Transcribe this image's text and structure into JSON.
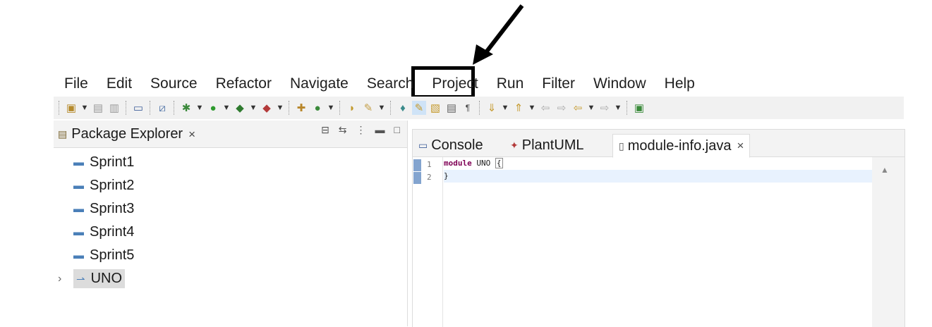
{
  "menubar": {
    "items": [
      "File",
      "Edit",
      "Source",
      "Refactor",
      "Navigate",
      "Search",
      "Project",
      "Run",
      "Filter",
      "Window",
      "Help"
    ]
  },
  "toolbar": {
    "icons": [
      "new-icon",
      "save-icon",
      "save-all-icon",
      "terminal-icon",
      "skip-breakpoints-icon",
      "debug-icon",
      "run-icon",
      "coverage-icon",
      "external-tools-icon",
      "new-java-package-icon",
      "new-class-icon",
      "open-type-icon",
      "search-icon",
      "toggle-annotation-icon",
      "mark-occurrences-icon",
      "show-whitespace-icon",
      "next-annotation-icon",
      "previous-annotation-icon",
      "back-icon",
      "forward-icon",
      "pin-editor-icon"
    ]
  },
  "package_explorer": {
    "title": "Package Explorer",
    "close": "×",
    "items": [
      {
        "label": "Sprint1"
      },
      {
        "label": "Sprint2"
      },
      {
        "label": "Sprint3"
      },
      {
        "label": "Sprint4"
      },
      {
        "label": "Sprint5"
      },
      {
        "label": "UNO",
        "expandable": true,
        "selected": true
      }
    ]
  },
  "editor": {
    "tabs": [
      {
        "label": "Console"
      },
      {
        "label": "PlantUML"
      },
      {
        "label": "module-info.java",
        "active": true,
        "close": "×"
      }
    ],
    "lines": [
      {
        "num": "1",
        "keyword": "module",
        "rest": " UNO ",
        "bracket": "{"
      },
      {
        "num": "2",
        "text": "}"
      }
    ]
  },
  "annotation": {
    "highlighted_menu": "Project"
  }
}
